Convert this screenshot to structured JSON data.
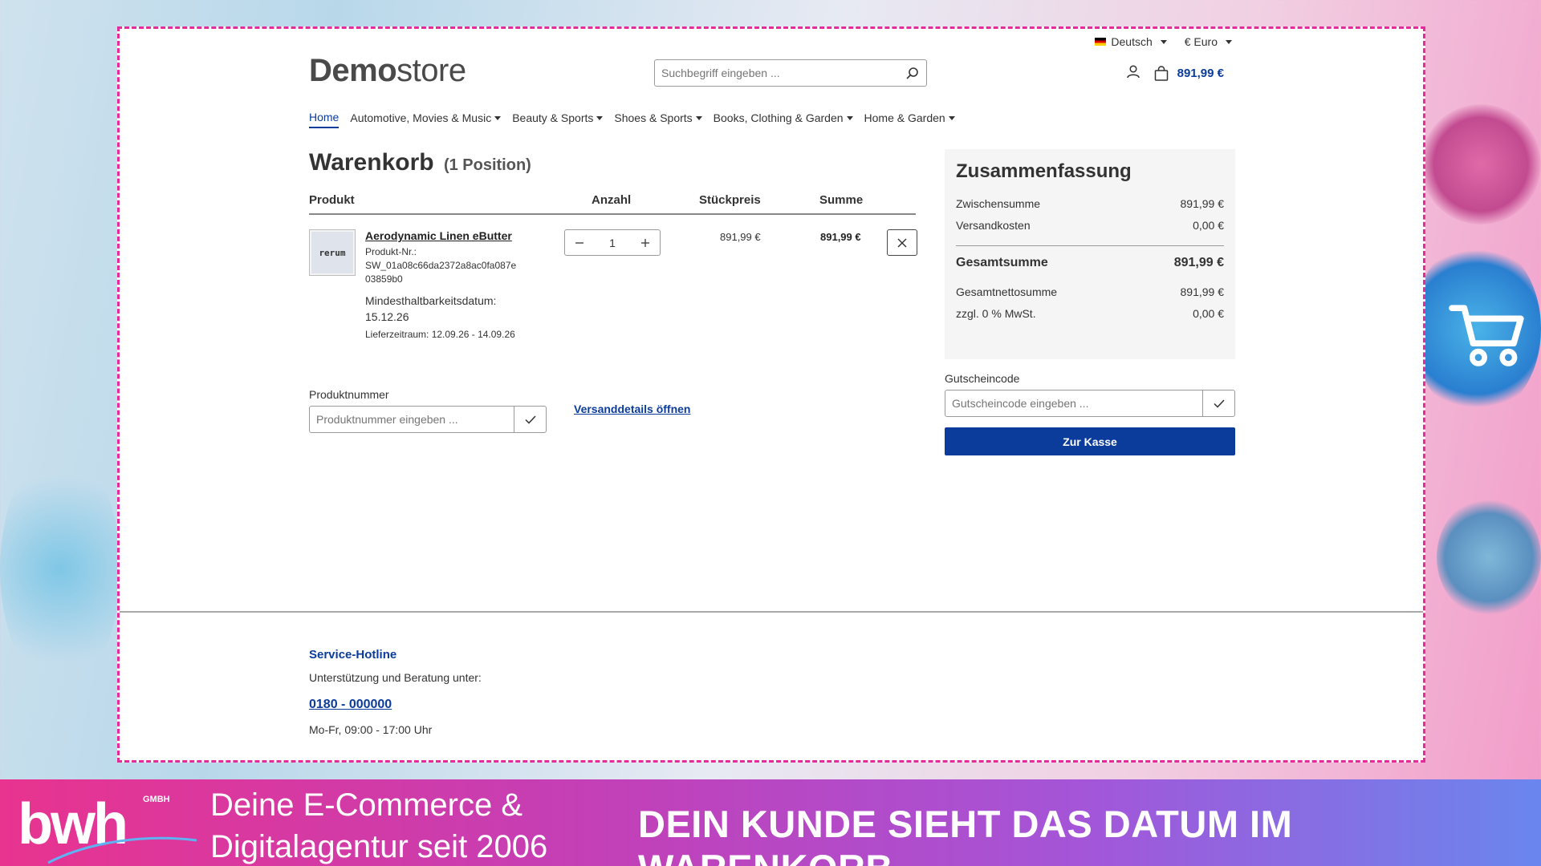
{
  "topbar": {
    "language": "Deutsch",
    "currency": "€ Euro"
  },
  "logo": {
    "bold": "Demo",
    "light": "store"
  },
  "search": {
    "placeholder": "Suchbegriff eingeben ..."
  },
  "header": {
    "cart_total": "891,99 €"
  },
  "nav": {
    "items": [
      {
        "label": "Home"
      },
      {
        "label": "Automotive, Movies & Music"
      },
      {
        "label": "Beauty & Sports"
      },
      {
        "label": "Shoes & Sports"
      },
      {
        "label": "Books, Clothing & Garden"
      },
      {
        "label": "Home & Garden"
      }
    ]
  },
  "cart": {
    "title": "Warenkorb",
    "count": "(1 Position)",
    "columns": {
      "product": "Produkt",
      "quantity": "Anzahl",
      "unit_price": "Stückpreis",
      "sum": "Summe"
    },
    "item": {
      "thumb_text": "rerum",
      "name": "Aerodynamic Linen eButter",
      "sku_label": "Produkt-Nr.:",
      "sku_line1": "SW_01a08c66da2372a8ac0fa087e",
      "sku_line2": "03859b0",
      "mhd_label": "Mindesthaltbarkeitsdatum:",
      "mhd_value": "15.12.26",
      "delivery": "Lieferzeitraum: 12.09.26 - 14.09.26",
      "quantity": "1",
      "unit_price": "891,99 €",
      "sum": "891,99 €"
    },
    "product_number": {
      "label": "Produktnummer",
      "placeholder": "Produktnummer eingeben ..."
    },
    "shipping_link": "Versanddetails öffnen"
  },
  "summary": {
    "title": "Zusammenfassung",
    "subtotal_label": "Zwischensumme",
    "subtotal_value": "891,99 €",
    "shipping_label": "Versandkosten",
    "shipping_value": "0,00 €",
    "total_label": "Gesamtsumme",
    "total_value": "891,99 €",
    "net_label": "Gesamtnettosumme",
    "net_value": "891,99 €",
    "tax_label": "zzgl. 0 % MwSt.",
    "tax_value": "0,00 €"
  },
  "voucher": {
    "label": "Gutscheincode",
    "placeholder": "Gutscheincode eingeben ..."
  },
  "checkout": {
    "label": "Zur Kasse"
  },
  "footer": {
    "title": "Service-Hotline",
    "text": "Unterstützung und Beratung unter:",
    "phone": "0180 - 000000",
    "hours": "Mo-Fr, 09:00 - 17:00 Uhr"
  },
  "banner": {
    "logo_text": "bwh",
    "logo_suffix": "GMBH",
    "tagline_line1": "Deine E-Commerce &",
    "tagline_line2": "Digitalagentur seit 2006",
    "headline": "DEIN KUNDE SIEHT DAS DATUM IM WARENKORB"
  },
  "colors": {
    "brand_blue": "#0b3c9c",
    "frame_dash": "#e52b9a"
  }
}
